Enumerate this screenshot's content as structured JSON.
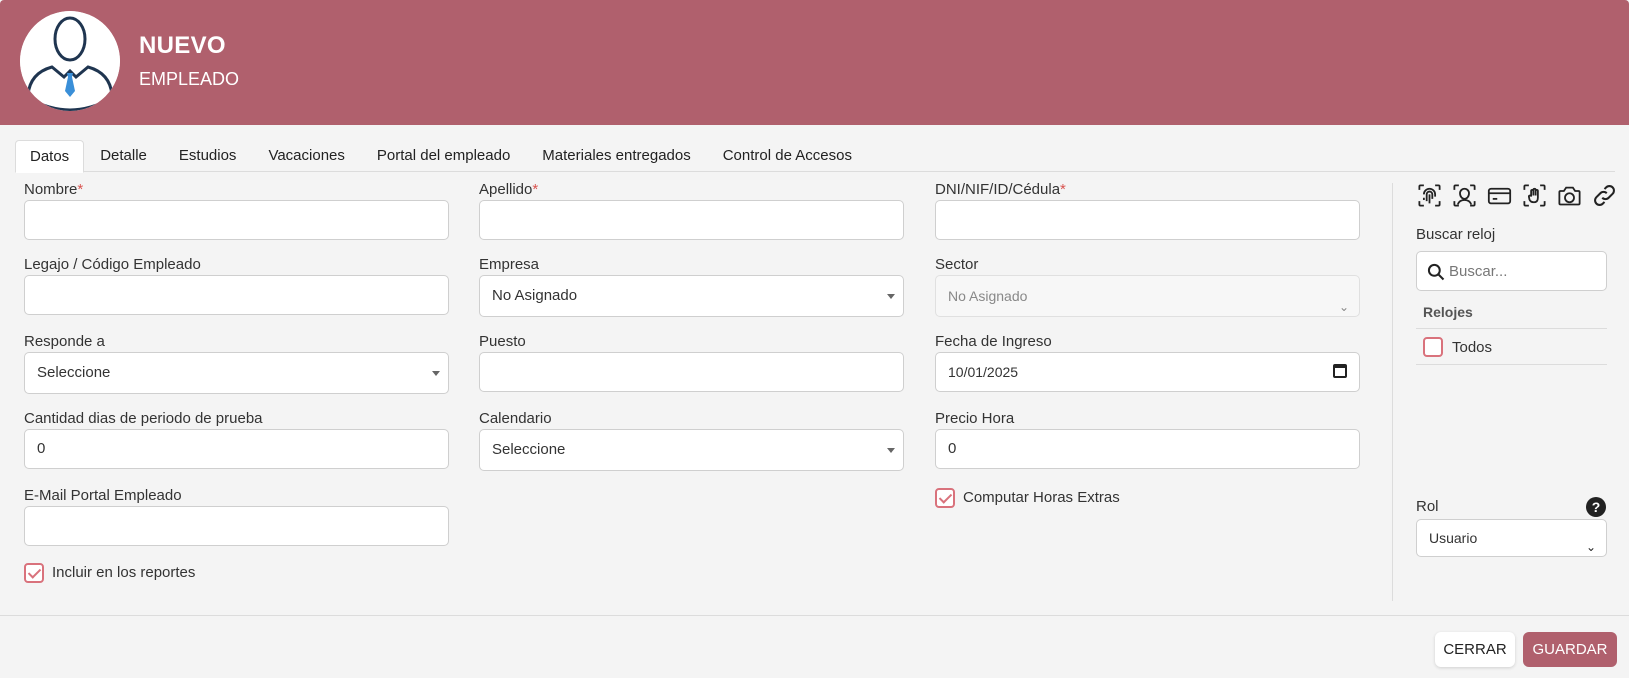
{
  "header": {
    "title": "NUEVO",
    "subtitle": "EMPLEADO"
  },
  "tabs": [
    {
      "label": "Datos",
      "active": true
    },
    {
      "label": "Detalle"
    },
    {
      "label": "Estudios"
    },
    {
      "label": "Vacaciones"
    },
    {
      "label": "Portal del empleado"
    },
    {
      "label": "Materiales entregados"
    },
    {
      "label": "Control de Accesos"
    }
  ],
  "form": {
    "nombre": {
      "label": "Nombre",
      "required": "*",
      "value": ""
    },
    "apellido": {
      "label": "Apellido",
      "required": "*",
      "value": ""
    },
    "dni": {
      "label": "DNI/NIF/ID/Cédula",
      "required": "*",
      "value": ""
    },
    "legajo": {
      "label": "Legajo / Código Empleado",
      "value": ""
    },
    "empresa": {
      "label": "Empresa",
      "value": "No Asignado"
    },
    "sector": {
      "label": "Sector",
      "value": "No Asignado"
    },
    "responde": {
      "label": "Responde a",
      "value": "Seleccione"
    },
    "puesto": {
      "label": "Puesto",
      "value": ""
    },
    "fecha_ingreso": {
      "label": "Fecha de Ingreso",
      "value": "10/01/2025"
    },
    "dias_prueba": {
      "label": "Cantidad dias de periodo de prueba",
      "value": "0"
    },
    "calendario": {
      "label": "Calendario",
      "value": "Seleccione"
    },
    "precio_hora": {
      "label": "Precio Hora",
      "value": "0"
    },
    "email_portal": {
      "label": "E-Mail Portal Empleado",
      "value": ""
    },
    "computar_horas": {
      "label": "Computar Horas Extras",
      "checked": true
    },
    "incluir_reportes": {
      "label": "Incluir en los reportes",
      "checked": true
    }
  },
  "sidebar": {
    "icons": [
      "fingerprint-icon",
      "face-id-icon",
      "card-icon",
      "palm-scan-icon",
      "camera-icon",
      "link-icon"
    ],
    "search_label": "Buscar reloj",
    "search_placeholder": "Buscar...",
    "relojes_heading": "Relojes",
    "todos_label": "Todos",
    "rol_label": "Rol",
    "rol_value": "Usuario",
    "help_glyph": "?"
  },
  "footer": {
    "close_label": "CERRAR",
    "save_label": "GUARDAR"
  },
  "colors": {
    "brand": "#b0606d",
    "required": "#d9534f",
    "checkbox": "#d9727c"
  }
}
